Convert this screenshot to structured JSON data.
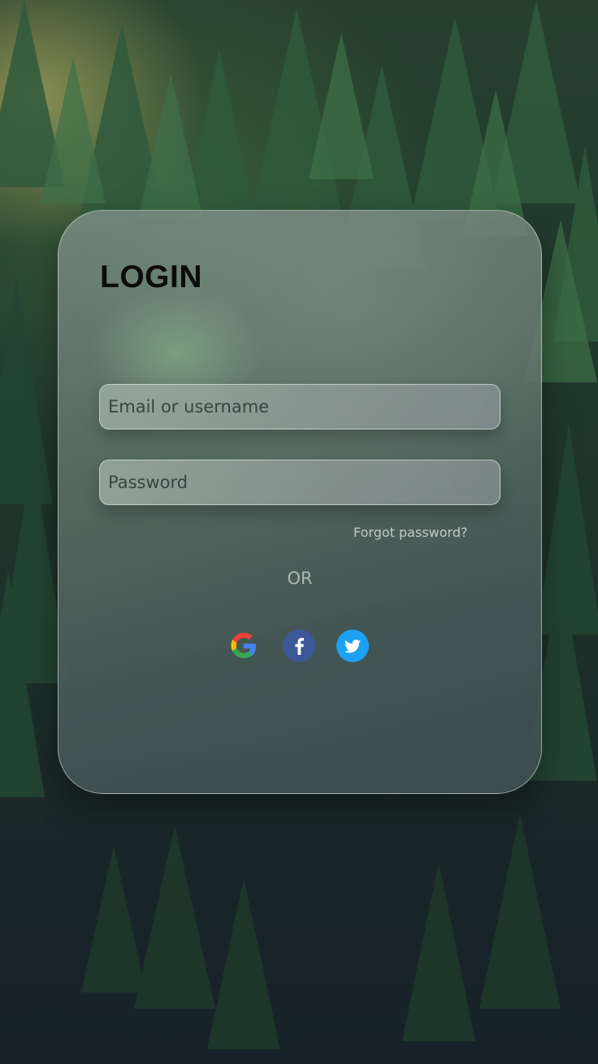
{
  "login": {
    "title": "LOGIN",
    "email_placeholder": "Email or username",
    "password_placeholder": "Password",
    "forgot_password": "Forgot password?",
    "or_divider": "OR"
  },
  "social": [
    {
      "name": "google",
      "icon": "google-icon"
    },
    {
      "name": "facebook",
      "icon": "facebook-icon",
      "color": "#3b5998"
    },
    {
      "name": "twitter",
      "icon": "twitter-icon",
      "color": "#1da1f2"
    }
  ]
}
